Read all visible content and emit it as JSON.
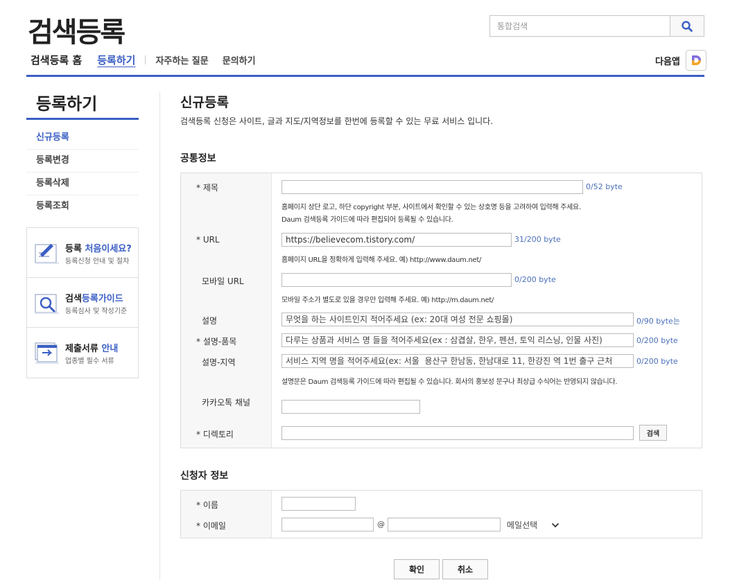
{
  "header": {
    "logo": "검색등록",
    "search_placeholder": "통합검색",
    "nav": {
      "home": "검색등록 홈",
      "register": "등록하기",
      "faq": "자주하는 질문",
      "contact": "문의하기"
    },
    "daum_app": "다음앱",
    "accent_color": "#3b5fc4"
  },
  "sidebar": {
    "title": "등록하기",
    "items": [
      "신규등록",
      "등록변경",
      "등록삭제",
      "등록조회"
    ],
    "banners": [
      {
        "title_a": "등록 ",
        "title_b": "처음이세요?",
        "sub": "등록신청 안내 및 절차",
        "icon": "pencil-doc-icon"
      },
      {
        "title_a": "검색",
        "title_b": "등록가이드",
        "sub": "등록심사 및 작성기준",
        "icon": "magnifier-doc-icon"
      },
      {
        "title_a": "제출서류 ",
        "title_b": "안내",
        "sub": "업종별 필수 서류",
        "icon": "document-arrow-icon"
      }
    ]
  },
  "main": {
    "title": "신규등록",
    "desc": "검색등록 신청은 사이트, 글과 지도/지역정보를 한번에 등록할 수 있는 무료 서비스 입니다.",
    "common_section": {
      "title": "공통정보",
      "title_label": "* 제목",
      "title_value": "",
      "title_count": "0/52 byte",
      "title_help_1": "홈페이지 상단 로고, 하단 copyright 부분, 사이트에서 확인할 수 있는 상호명 등을 고려하여 입력해 주세요.",
      "title_help_2": "Daum 검색등록 가이드에 따라 편집되어 등록될 수 있습니다.",
      "url_label": "* URL",
      "url_value": "https://believecom.tistory.com/",
      "url_count": "31/200 byte",
      "url_help": "홈페이지 URL을 정확하게 입력해 주세요. 예) http://www.daum.net/",
      "mobile_label": "모바일 URL",
      "mobile_value": "",
      "mobile_count": "0/200 byte",
      "mobile_help": "모바일 주소가 별도로 있을 경우만 입력해 주세요. 예) http://m.daum.net/",
      "desc_label": "설명",
      "desc_placeholder": "무엇을 하는 사이트인지 적어주세요 (ex: 20대 여성 전문 쇼핑몰)",
      "desc_count": "0/90 byte는",
      "items_label": "* 설명-품목",
      "items_placeholder": "다루는 상품과 서비스 명 들을 적어주세요(ex : 삼겹살, 한우, 펜션, 토익 리스닝, 인물 사진)",
      "items_count": "0/200 byte",
      "region_label": "설명-지역",
      "region_placeholder": "서비스 지역 명을 적어주세요(ex: 서울  용산구 한남동, 한남대로 11, 한강진 역 1번 출구 근처",
      "region_count": "0/200 byte",
      "desc_help": "설명문은 Daum 검색등록 가이드에 따라 편집될 수 있습니다. 회사의 홍보성 문구나 최상급 수식어는 반영되지 않습니다.",
      "kakao_label": "카카오톡 채널",
      "kakao_value": "",
      "dir_label": "* 디렉토리",
      "dir_value": "",
      "dir_button": "검색"
    },
    "applicant_section": {
      "title": "신청자 정보",
      "name_label": "* 이름",
      "name_value": "",
      "email_label": "* 이메일",
      "email_id": "",
      "email_at": "@",
      "email_domain": "",
      "email_select": "메일선택"
    },
    "buttons": {
      "confirm": "확인",
      "cancel": "취소"
    }
  }
}
